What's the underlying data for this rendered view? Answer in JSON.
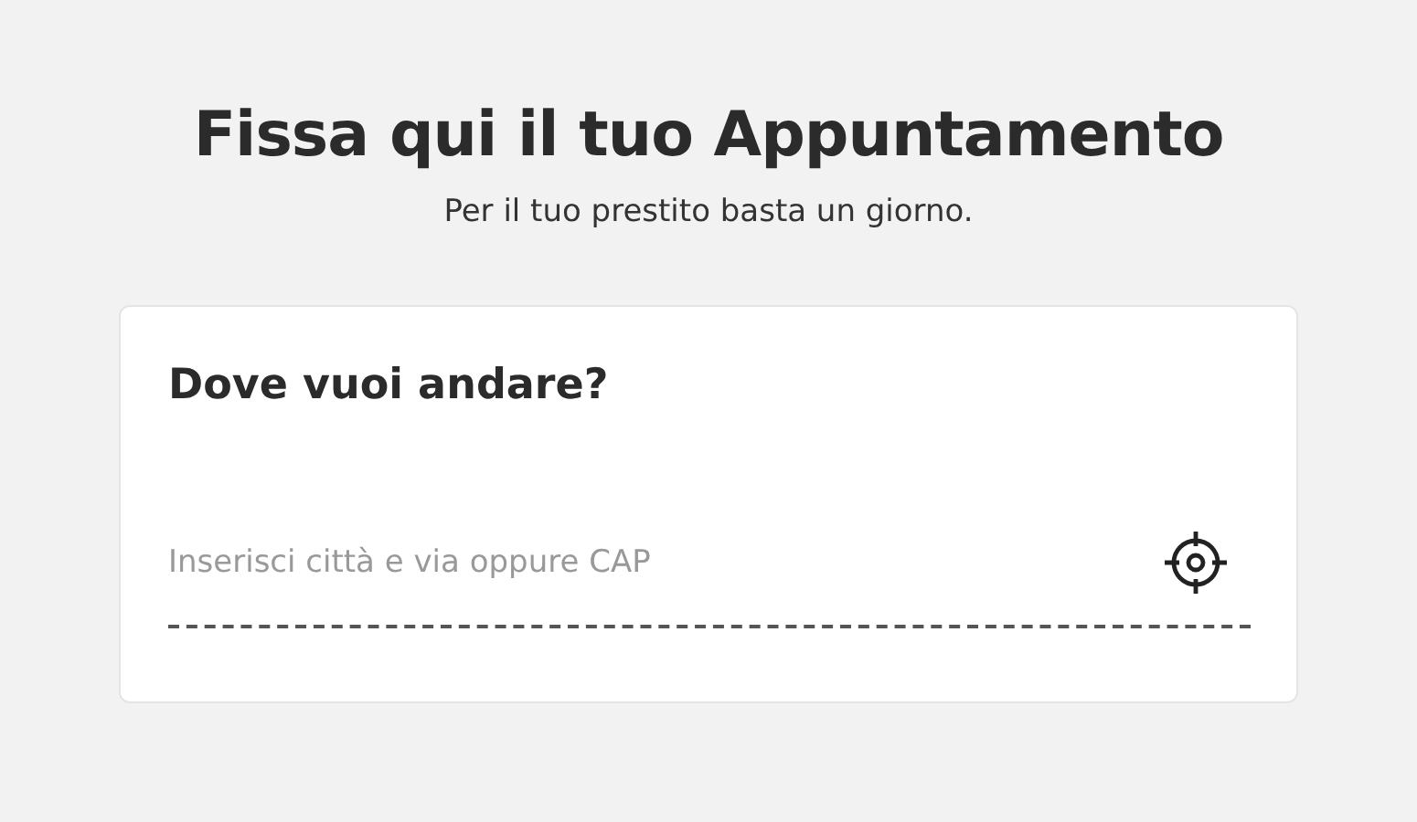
{
  "header": {
    "title": "Fissa qui il tuo Appuntamento",
    "subtitle": "Per il tuo prestito basta un giorno."
  },
  "card": {
    "heading": "Dove vuoi andare?",
    "search": {
      "placeholder": "Inserisci città e via oppure CAP"
    }
  }
}
